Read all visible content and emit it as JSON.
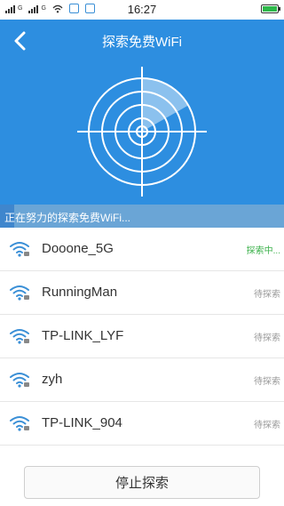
{
  "status_bar": {
    "time": "16:27",
    "net1": "G",
    "net2": "G",
    "icons": [
      "signal-icon",
      "signal-icon",
      "wifi-icon",
      "app-icon",
      "app-icon",
      "battery-icon"
    ]
  },
  "header": {
    "title": "探索免费WiFi",
    "back_icon": "chevron-left-icon"
  },
  "progress": {
    "text": "正在努力的探索免费WiFi...",
    "fraction": 0.05
  },
  "networks": [
    {
      "ssid": "Dooone_5G",
      "status": "探索中...",
      "active": true
    },
    {
      "ssid": "RunningMan",
      "status": "待探索",
      "active": false
    },
    {
      "ssid": "TP-LINK_LYF",
      "status": "待探索",
      "active": false
    },
    {
      "ssid": "zyh",
      "status": "待探索",
      "active": false
    },
    {
      "ssid": "TP-LINK_904",
      "status": "待探索",
      "active": false
    }
  ],
  "stop_button": {
    "label": "停止探索"
  },
  "colors": {
    "header_bg": "#2d8ee0",
    "active_status": "#3bb14a",
    "pending_status": "#999999",
    "wifi_icon": "#3a8fd6"
  }
}
